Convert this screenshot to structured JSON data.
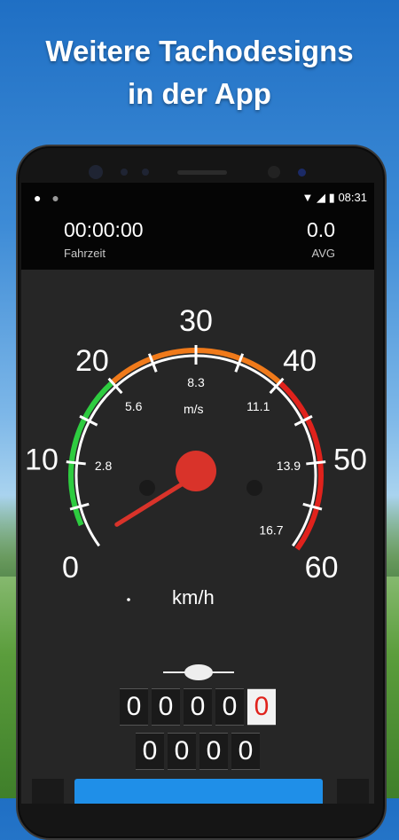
{
  "promo": {
    "line1": "Weitere Tachodesigns",
    "line2": "in der App"
  },
  "status_bar": {
    "time": "08:31",
    "left_icons": [
      "keyhole-icon",
      "record-icon"
    ],
    "right_icons": [
      "wifi-icon",
      "signal-icon",
      "battery-icon"
    ]
  },
  "header": {
    "time_value": "00:00:00",
    "time_label": "Fahrzeit",
    "avg_value": "0.0",
    "avg_label": "AVG"
  },
  "speedometer": {
    "current_speed_kmh": 0,
    "unit_primary": "km/h",
    "unit_secondary": "m/s",
    "major_labels": [
      "0",
      "10",
      "20",
      "30",
      "40",
      "50",
      "60"
    ],
    "minor_labels": [
      "2.8",
      "5.6",
      "8.3",
      "11.1",
      "13.9",
      "16.7"
    ],
    "zones": {
      "green": "#2ecc40",
      "orange": "#f07a1a",
      "red": "#e0221c"
    },
    "needle_color": "#d9332a"
  },
  "odometer": {
    "total_digits": [
      "0",
      "0",
      "0",
      "0",
      "0"
    ],
    "trip_digits": [
      "0",
      "0",
      "0",
      "0"
    ]
  },
  "colors": {
    "accent_button": "#1f8fe8",
    "screen_bg": "#262626"
  }
}
